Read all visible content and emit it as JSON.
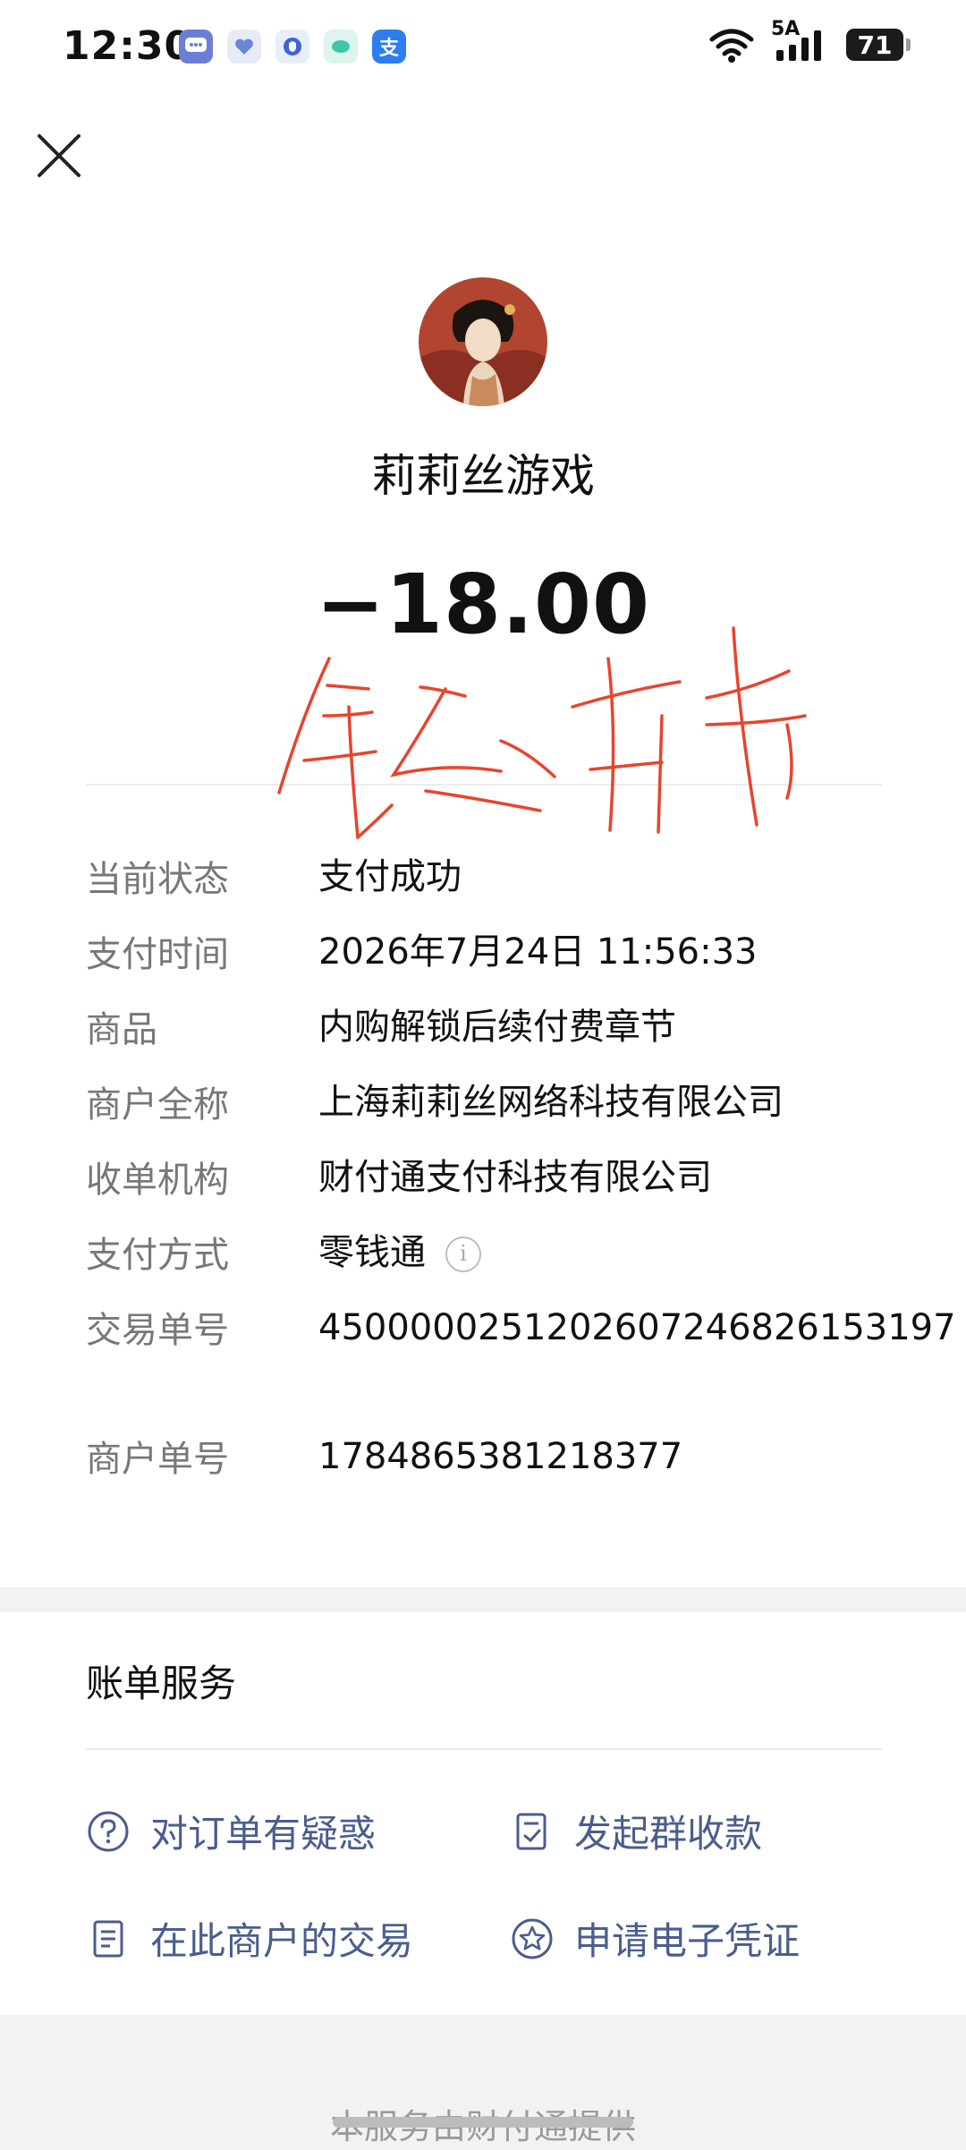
{
  "status_bar": {
    "time": "12:30",
    "network_label": "5A",
    "battery": "71",
    "app_icons": [
      "chat-icon",
      "heart-app-icon",
      "shield-app-icon",
      "bubble-app-icon",
      "alipay-icon"
    ],
    "alipay_glyph": "支"
  },
  "header": {
    "close_icon": "close-icon"
  },
  "merchant": {
    "name": "莉莉丝游戏"
  },
  "payment": {
    "amount": "−18.00"
  },
  "details": [
    {
      "label": "当前状态",
      "value": "支付成功"
    },
    {
      "label": "支付时间",
      "value": "2026年7月24日 11:56:33"
    },
    {
      "label": "商品",
      "value": "内购解锁后续付费章节"
    },
    {
      "label": "商户全称",
      "value": "上海莉莉丝网络科技有限公司"
    },
    {
      "label": "收单机构",
      "value": "财付通支付科技有限公司"
    },
    {
      "label": "支付方式",
      "value": "零钱通"
    },
    {
      "label": "交易单号",
      "value": "4500000251202607246826153197"
    },
    {
      "label": "商户单号",
      "value": "1784865381218377"
    }
  ],
  "info_glyph": "i",
  "bill_service": {
    "title": "账单服务",
    "items": [
      {
        "label": "对订单有疑惑",
        "icon": "question-circle-icon"
      },
      {
        "label": "发起群收款",
        "icon": "group-receipt-icon"
      },
      {
        "label": "在此商户的交易",
        "icon": "document-icon"
      },
      {
        "label": "申请电子凭证",
        "icon": "star-badge-icon"
      }
    ]
  },
  "footer": {
    "text": "本服务由财付通提供"
  },
  "colors": {
    "link": "#4a5d8d",
    "scribble": "#e8442e"
  }
}
